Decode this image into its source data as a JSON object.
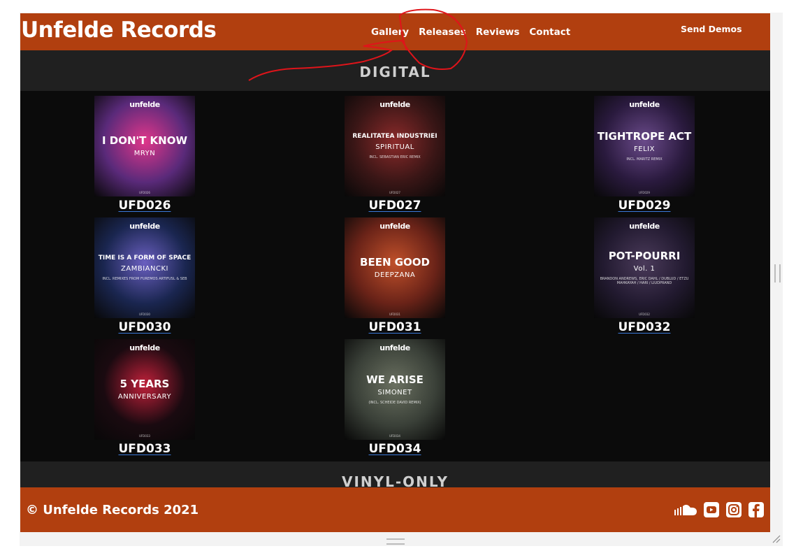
{
  "header": {
    "brand": "Unfelde Records",
    "nav": [
      "Gallery",
      "Releases",
      "Reviews",
      "Contact"
    ],
    "send_demos": "Send Demos"
  },
  "sections": {
    "digital": "DIGITAL",
    "vinyl": "VINYL-ONLY"
  },
  "releases": [
    {
      "code": "UFD026",
      "title": "I DON'T KNOW",
      "artist": "MRYN",
      "bg": "#5a2a7a",
      "accent": "#e0368a"
    },
    {
      "code": "UFD027",
      "title": "REALITATEA INDUSTRIEI",
      "artist": "SPIRITUAL",
      "remix": "INCL. SEBASTIAN ERIC REMIX",
      "bg": "#3a1616",
      "accent": "#8b2a2a"
    },
    {
      "code": "UFD029",
      "title": "TIGHTROPE ACT",
      "artist": "FELIX",
      "remix": "INCL. MARITZ REMIX",
      "bg": "#2a1a3e",
      "accent": "#6a4a8a"
    },
    {
      "code": "UFD030",
      "title": "TIME IS A FORM OF SPACE",
      "artist": "ZAMBIANCKI",
      "remix": "INCL. REMIXES FROM FUREMOS ARTIFUSL & SEB",
      "bg": "#1a2650",
      "accent": "#6a5fc0"
    },
    {
      "code": "UFD031",
      "title": "BEEN GOOD",
      "artist": "DEEPZANA",
      "bg": "#6a2318",
      "accent": "#c0502a"
    },
    {
      "code": "UFD032",
      "title": "POT-POURRI",
      "artist": "Vol. 1",
      "remix": "BRANDON ANDREWS, ERIC DAHL / DUBLUD / ETZU MAHKAYAH / HARI / LIUDPRAND",
      "bg": "#221a30",
      "accent": "#4a3a5a"
    },
    {
      "code": "UFD033",
      "title": "5 YEARS",
      "artist": "ANNIVERSARY",
      "bg": "#1a0a10",
      "accent": "#c0203a"
    },
    {
      "code": "UFD034",
      "title": "WE ARISE",
      "artist": "SIMONET",
      "remix": "(INCL. SCHEIDE DAVID REMIX)",
      "bg": "#3a4038",
      "accent": "#6a7060"
    }
  ],
  "cover_logo": "unfelde",
  "footer": {
    "copyright": "© Unfelde Records 2021",
    "social": [
      "soundcloud-icon",
      "youtube-icon",
      "instagram-icon",
      "facebook-icon"
    ]
  }
}
